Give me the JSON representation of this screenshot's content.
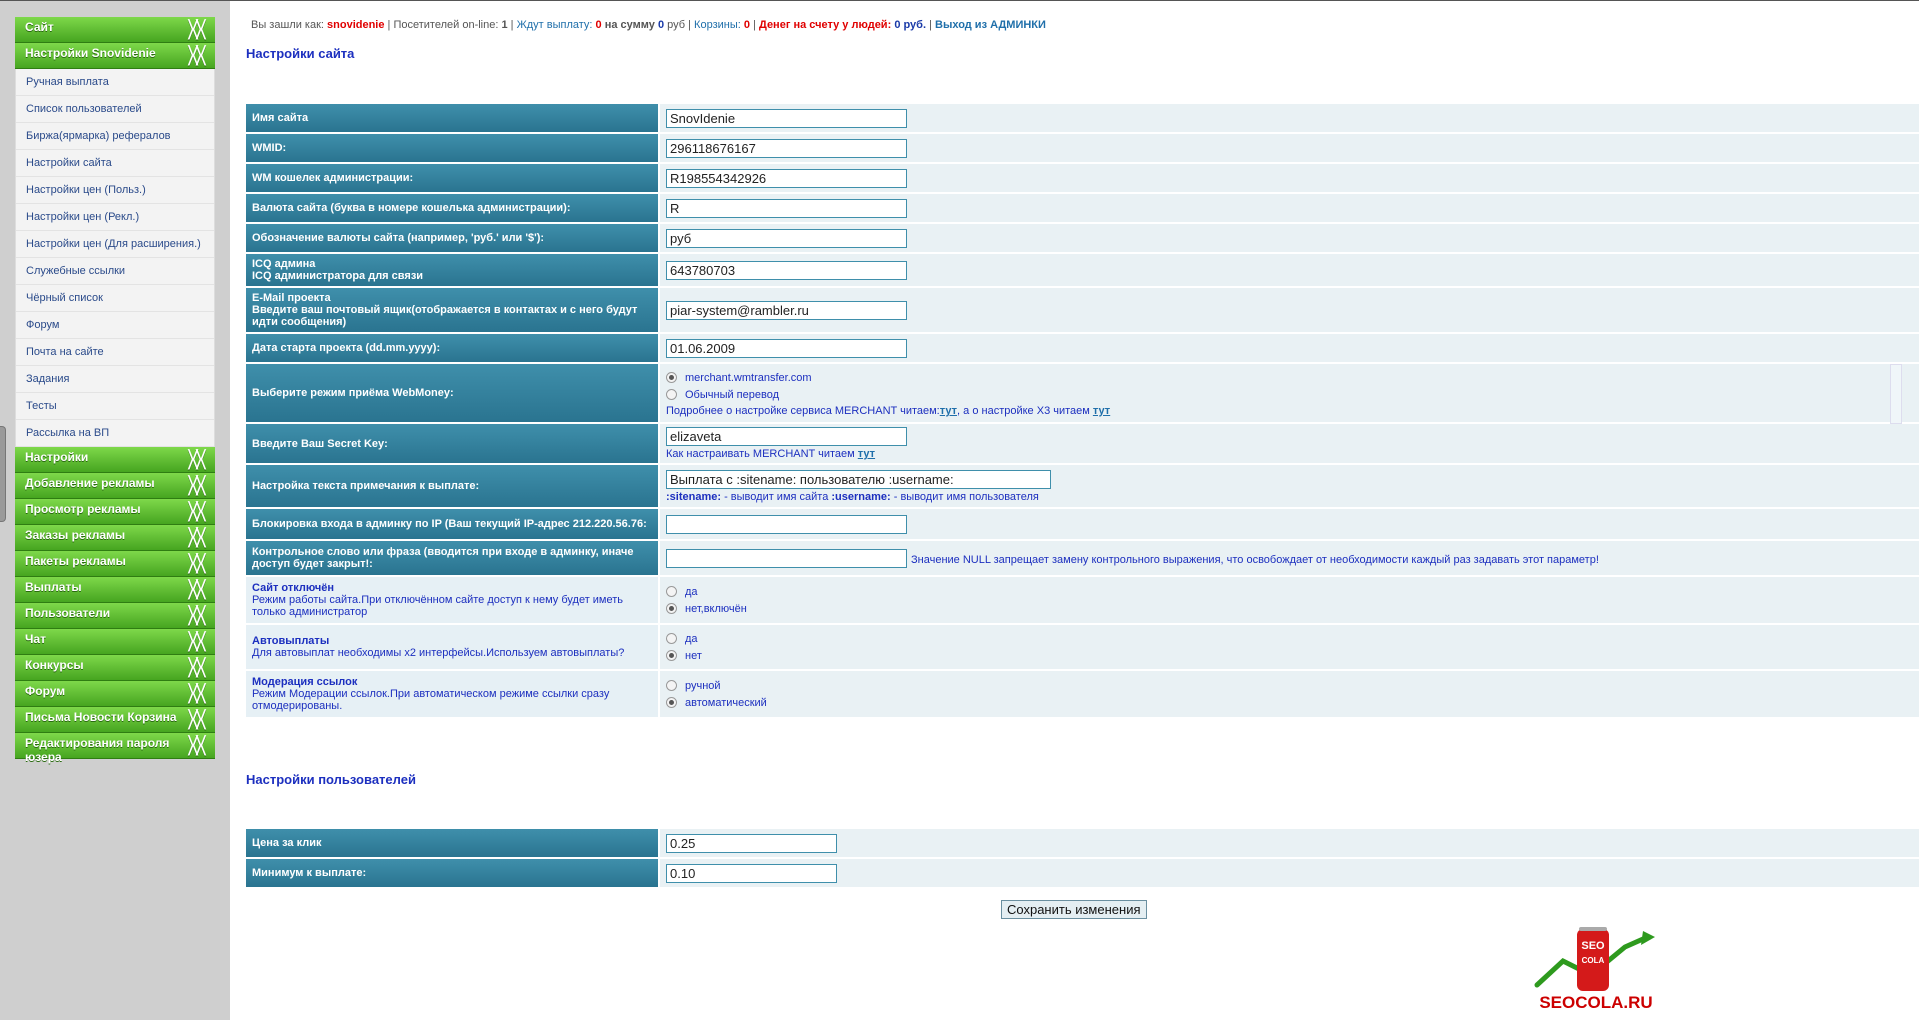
{
  "sidebar": {
    "head_site": "Сайт",
    "head_settings": "Настройки Snovidenie",
    "items": [
      "Ручная выплата",
      "Список пользователей",
      "Биржа(ярмарка) рефералов",
      "Настройки сайта",
      "Настройки цен (Польз.)",
      "Настройки цен (Рекл.)",
      "Настройки цен (Для расширения.)",
      "Служебные ссылки",
      "Чёрный список",
      "Форум",
      "Почта на сайте",
      "Задания",
      "Тесты",
      "Рассылка на ВП"
    ],
    "groups": [
      "Настройки",
      "Добавление рекламы",
      "Просмотр рекламы",
      "Заказы рекламы",
      "Пакеты рекламы",
      "Выплаты",
      "Пользователи",
      "Чат",
      "Конкурсы",
      "Форум",
      "Письма Новости Корзина",
      "Редактирования пароля юзера"
    ]
  },
  "topbar": {
    "logged_as_label": "Вы зашли как:",
    "user": "snovidenie",
    "online_label": "Посетителей on-line:",
    "online_count": "1",
    "wait_payout_label": "Ждут выплату:",
    "wait_payout_count": "0",
    "sum_label": "на сумму",
    "sum_value": "0",
    "sum_unit": "руб",
    "carts_label": "Корзины:",
    "carts_count": "0",
    "money_label": "Денег на счету у людей:",
    "money_value": "0 руб.",
    "exit_label": "Выход из АДМИНКИ"
  },
  "site_settings": {
    "title": "Настройки сайта",
    "site_name_label": "Имя сайта",
    "site_name_value": "SnovIdenie",
    "wmid_label": "WMID:",
    "wmid_value": "296118676167",
    "wm_wallet_label": "WM кошелек администрации:",
    "wm_wallet_value": "R198554342926",
    "currency_letter_label": "Валюта сайта (буква в номере кошелька администрации):",
    "currency_letter_value": "R",
    "currency_symbol_label": "Обозначение валюты сайта (например, 'руб.' или '$'):",
    "currency_symbol_value": "руб",
    "icq_label_1": "ICQ админа",
    "icq_label_2": "ICQ администратора для связи",
    "icq_value": "643780703",
    "email_label_1": "E-Mail проекта",
    "email_label_2": "Введите ваш почтовый ящик(отображается в контактах и с него будут идти сообщения)",
    "email_value": "piar-system@rambler.ru",
    "start_date_label": "Дата старта проекта (dd.mm.yyyy):",
    "start_date_value": "01.06.2009",
    "wm_mode_label": "Выберите режим приёма WebMoney:",
    "wm_mode_opt1": "merchant.wmtransfer.com",
    "wm_mode_opt2": "Обычный перевод",
    "wm_mode_hint_a": "Подробнее о настройке сервиса MERCHANT читаем:",
    "wm_mode_hint_link": "тут",
    "wm_mode_hint_b": ", а о настройке X3 читаем",
    "secret_label": "Введите Ваш Secret Key:",
    "secret_value": "elizaveta",
    "secret_hint": "Как настраивать MERCHANT читаем",
    "secret_hint_link": "тут",
    "note_label": "Настройка текста примечания к выплате:",
    "note_value": "Выплата с :sitename: пользователю :username:",
    "note_hint_k1": ":sitename:",
    "note_hint_t1": " - выводит имя сайта ",
    "note_hint_k2": ":username:",
    "note_hint_t2": " - выводит имя пользователя",
    "ip_block_label": "Блокировка входа в админку по IP (Ваш текущий IP-адрес 212.220.56.76:",
    "ip_block_value": "",
    "control_label": "Контрольное слово или фраза (вводится при входе в админку, иначе доступ будет закрыт!:",
    "control_value": "",
    "control_note": "Значение NULL запрещает замену контрольного выражения, что освобождает от необходимости каждый раз задавать этот параметр!",
    "site_off_label": "Сайт отключён",
    "site_off_desc": "Режим работы сайта.При отключённом сайте доступ к нему будет иметь только администратор",
    "site_off_opt1": "да",
    "site_off_opt2": "нет,включён",
    "autopay_label": "Автовыплаты",
    "autopay_desc": "Для автовыплат необходимы x2 интерфейсы.Используем автовыплаты?",
    "autopay_opt1": "да",
    "autopay_opt2": "нет",
    "moderation_label": "Модерация ссылок",
    "moderation_desc": "Режим Модерации ссылок.При автоматическом режиме ссылки сразу отмодерированы.",
    "moderation_opt1": "ручной",
    "moderation_opt2": "автоматический"
  },
  "user_settings": {
    "title": "Настройки пользователей",
    "click_price_label": "Цена за клик",
    "click_price_value": "0.25",
    "min_payout_label": "Минимум к выплате:",
    "min_payout_value": "0.10"
  },
  "save_label": "Сохранить изменения",
  "logo": {
    "can_line1": "SEO",
    "can_line2": "COLA",
    "site": "SEOCOLA.RU"
  }
}
